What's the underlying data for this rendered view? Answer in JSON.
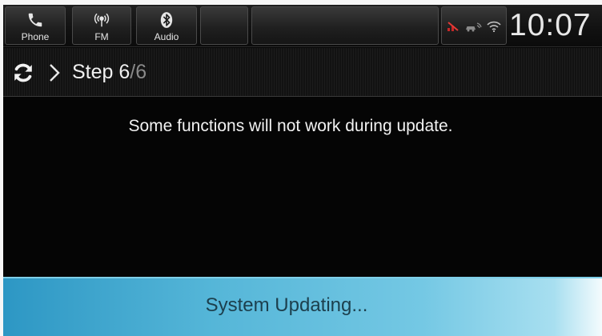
{
  "topbar": {
    "shortcuts": [
      {
        "label": "Phone",
        "icon": "phone-icon"
      },
      {
        "label": "FM",
        "icon": "radio-icon"
      },
      {
        "label": "Audio",
        "icon": "bluetooth-icon"
      }
    ],
    "clock": "10:07",
    "status_icons": [
      "no-signal-icon",
      "car-connection-icon",
      "wifi-icon"
    ]
  },
  "step": {
    "prefix": "Step",
    "current": "6",
    "total": "/6"
  },
  "message": "Some functions will not work during update.",
  "footer": {
    "status": "System Updating..."
  },
  "colors": {
    "accent": "#4fb3d9",
    "background": "#050505"
  }
}
